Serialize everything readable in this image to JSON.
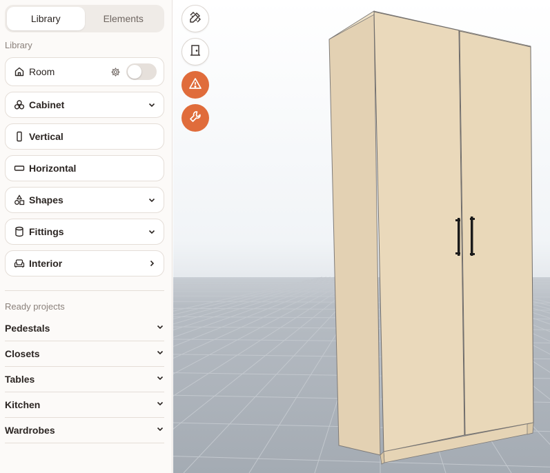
{
  "tabs": [
    {
      "label": "Library",
      "active": true
    },
    {
      "label": "Elements",
      "active": false
    }
  ],
  "library": {
    "title": "Library",
    "room": {
      "label": "Room",
      "toggle_on": false
    },
    "items": [
      {
        "label": "Cabinet",
        "icon": "cabinet-icon",
        "chevron": "down"
      },
      {
        "label": "Vertical",
        "icon": "vertical-icon",
        "chevron": "none"
      },
      {
        "label": "Horizontal",
        "icon": "horizontal-icon",
        "chevron": "none"
      },
      {
        "label": "Shapes",
        "icon": "shapes-icon",
        "chevron": "down"
      },
      {
        "label": "Fittings",
        "icon": "fittings-icon",
        "chevron": "down"
      },
      {
        "label": "Interior",
        "icon": "interior-icon",
        "chevron": "right"
      }
    ]
  },
  "ready_projects": {
    "title": "Ready projects",
    "items": [
      {
        "label": "Pedestals"
      },
      {
        "label": "Closets"
      },
      {
        "label": "Tables"
      },
      {
        "label": "Kitchen"
      },
      {
        "label": "Wardrobes"
      }
    ]
  },
  "toolbar": [
    {
      "name": "ruler-pencil-icon",
      "style": "light"
    },
    {
      "name": "door-icon",
      "style": "light"
    },
    {
      "name": "warning-icon",
      "style": "orange"
    },
    {
      "name": "wrench-icon",
      "style": "orange"
    }
  ],
  "colors": {
    "accent": "#e06c3b",
    "panel": "#e8d8bd",
    "floor": "#a9b0b8"
  }
}
